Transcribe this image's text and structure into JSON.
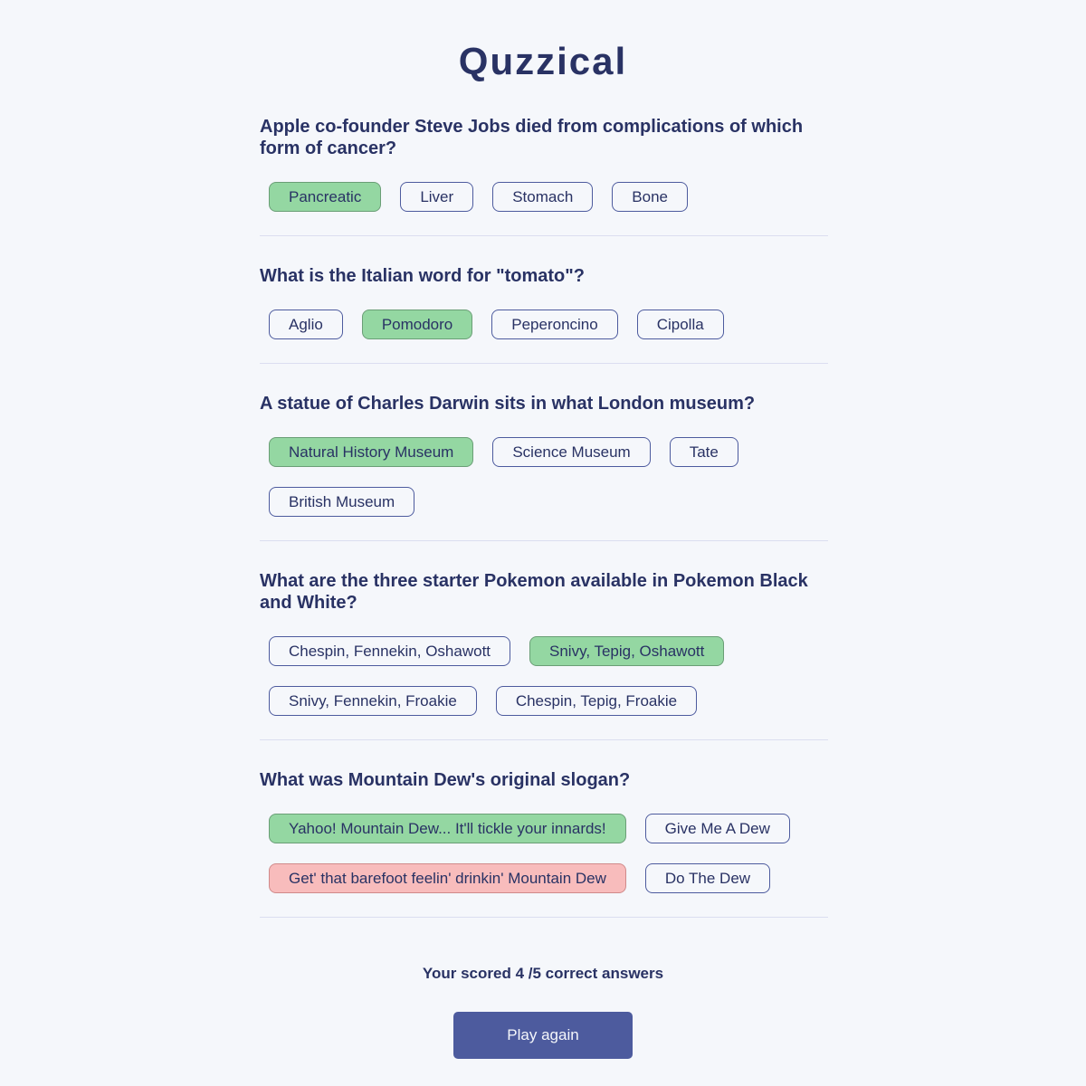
{
  "app": {
    "title": "Quzzical"
  },
  "questions": [
    {
      "question": "Apple co-founder Steve Jobs died from complications of which form of cancer?",
      "answers": [
        {
          "label": "Pancreatic",
          "state": "correct"
        },
        {
          "label": "Liver",
          "state": "neutral"
        },
        {
          "label": "Stomach",
          "state": "neutral"
        },
        {
          "label": "Bone",
          "state": "neutral"
        }
      ]
    },
    {
      "question": "What is the Italian word for \"tomato\"?",
      "answers": [
        {
          "label": "Aglio",
          "state": "neutral"
        },
        {
          "label": "Pomodoro",
          "state": "correct"
        },
        {
          "label": "Peperoncino",
          "state": "neutral"
        },
        {
          "label": "Cipolla",
          "state": "neutral"
        }
      ]
    },
    {
      "question": "A statue of Charles Darwin sits in what London museum?",
      "answers": [
        {
          "label": "Natural History Museum",
          "state": "correct"
        },
        {
          "label": "Science Museum",
          "state": "neutral"
        },
        {
          "label": "Tate",
          "state": "neutral"
        },
        {
          "label": "British Museum",
          "state": "neutral"
        }
      ]
    },
    {
      "question": "What are the three starter Pokemon available in Pokemon Black and White?",
      "answers": [
        {
          "label": "Chespin, Fennekin, Oshawott",
          "state": "neutral"
        },
        {
          "label": "Snivy, Tepig, Oshawott",
          "state": "correct"
        },
        {
          "label": "Snivy, Fennekin, Froakie",
          "state": "neutral"
        },
        {
          "label": "Chespin, Tepig, Froakie",
          "state": "neutral"
        }
      ]
    },
    {
      "question": "What was Mountain Dew's original slogan?",
      "answers": [
        {
          "label": "Yahoo! Mountain Dew... It'll tickle your innards!",
          "state": "correct"
        },
        {
          "label": "Give Me A Dew",
          "state": "neutral"
        },
        {
          "label": "Get' that barefoot feelin' drinkin' Mountain Dew",
          "state": "wrong"
        },
        {
          "label": "Do The Dew",
          "state": "neutral"
        }
      ]
    }
  ],
  "result": {
    "score_text": "Your scored 4 /5 correct answers",
    "correct": 4,
    "total": 5
  },
  "actions": {
    "play_again_label": "Play again"
  },
  "colors": {
    "correct": "#94d7a2",
    "wrong": "#f8bcbc",
    "primary": "#4d5b9e",
    "text": "#293264"
  }
}
